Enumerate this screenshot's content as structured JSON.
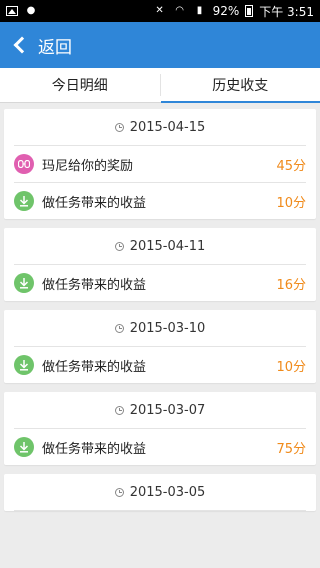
{
  "status_bar": {
    "battery": "92%",
    "time": "下午 3:51"
  },
  "header": {
    "back_label": "返回"
  },
  "tabs": [
    {
      "label": "今日明细"
    },
    {
      "label": "历史收支"
    }
  ],
  "records": [
    {
      "date": "2015-04-15",
      "items": [
        {
          "icon": "reward-icon",
          "label": "玛尼给你的奖励",
          "value": "45分"
        },
        {
          "icon": "download-icon",
          "label": "做任务带来的收益",
          "value": "10分"
        }
      ]
    },
    {
      "date": "2015-04-11",
      "items": [
        {
          "icon": "download-icon",
          "label": "做任务带来的收益",
          "value": "16分"
        }
      ]
    },
    {
      "date": "2015-03-10",
      "items": [
        {
          "icon": "download-icon",
          "label": "做任务带来的收益",
          "value": "10分"
        }
      ]
    },
    {
      "date": "2015-03-07",
      "items": [
        {
          "icon": "download-icon",
          "label": "做任务带来的收益",
          "value": "75分"
        }
      ]
    },
    {
      "date": "2015-03-05",
      "items": []
    }
  ],
  "colors": {
    "accent": "#2f86d8",
    "value": "#f08a1a",
    "reward_icon": "#e05fb0",
    "download_icon": "#6fc46a"
  }
}
